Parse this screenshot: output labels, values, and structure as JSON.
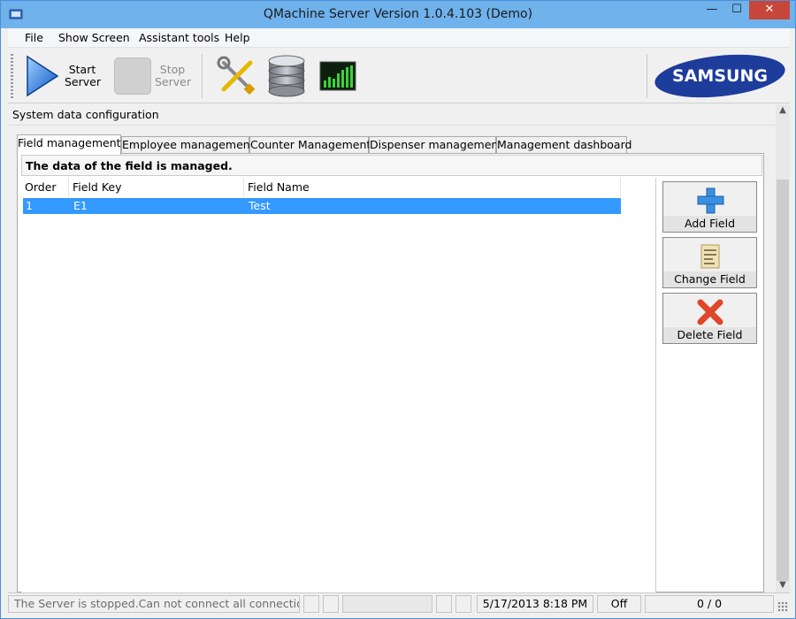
{
  "window": {
    "title": "QMachine Server Version 1.0.4.103 (Demo)",
    "min_glyph": "—",
    "max_glyph": "☐",
    "close_glyph": "✕"
  },
  "menu": {
    "items": [
      {
        "label": "File"
      },
      {
        "label": "Show Screen"
      },
      {
        "label": "Assistant tools"
      },
      {
        "label": "Help"
      }
    ]
  },
  "toolbar": {
    "start_line1": "Start",
    "start_line2": "Server",
    "stop_line1": "Stop",
    "stop_line2": "Server",
    "logo_text": "SAMSUNG",
    "icons": [
      "play-icon",
      "stop-icon",
      "tools-icon",
      "database-icon",
      "chart-icon"
    ]
  },
  "section": {
    "title": "System data configuration"
  },
  "tabs": [
    {
      "label": "Field management",
      "active": true
    },
    {
      "label": "Employee management"
    },
    {
      "label": "Counter Management"
    },
    {
      "label": "Dispenser management"
    },
    {
      "label": "Management dashboard"
    }
  ],
  "panel": {
    "description": "The data of the field is managed."
  },
  "table": {
    "columns": [
      "Order",
      "Field Key",
      "Field Name"
    ],
    "rows": [
      {
        "order": "1",
        "key": "E1",
        "name": "Test",
        "selected": true
      }
    ]
  },
  "actions": {
    "add": "Add Field",
    "change": "Change Field",
    "delete": "Delete Field"
  },
  "status": {
    "message": "The Server is stopped.Can not connect all connection.",
    "datetime": "5/17/2013 8:18 PM",
    "state": "Off",
    "count": "0 / 0"
  },
  "colors": {
    "titlebar": "#6fb2ec",
    "selection": "#3399ff",
    "delete_red": "#e0462a",
    "add_blue": "#3b8fe0",
    "logo_blue": "#1d3c9c"
  }
}
